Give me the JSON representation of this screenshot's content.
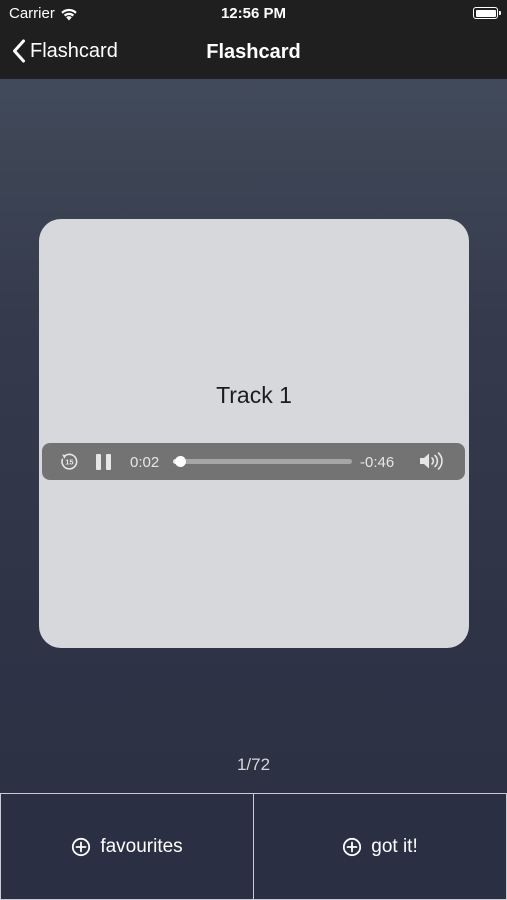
{
  "status_bar": {
    "carrier": "Carrier",
    "time": "12:56 PM",
    "icons": [
      "wifi-icon",
      "battery-icon"
    ]
  },
  "nav": {
    "back_label": "Flashcard",
    "title": "Flashcard"
  },
  "card": {
    "title": "Track 1",
    "player": {
      "elapsed": "0:02",
      "remaining": "-0:46",
      "progress": 0.04,
      "state": "playing",
      "skip_back_seconds": "15",
      "icons": [
        "skip-back-15-icon",
        "pause-icon",
        "volume-icon"
      ]
    }
  },
  "pager": {
    "counter": "1/72"
  },
  "actions": {
    "favourites_label": "favourites",
    "got_it_label": "got it!"
  },
  "colors": {
    "nav_background": "#1f1f1f",
    "card_background": "#d7d8dc",
    "player_background": "#737373",
    "button_background": "#2a2f44"
  }
}
